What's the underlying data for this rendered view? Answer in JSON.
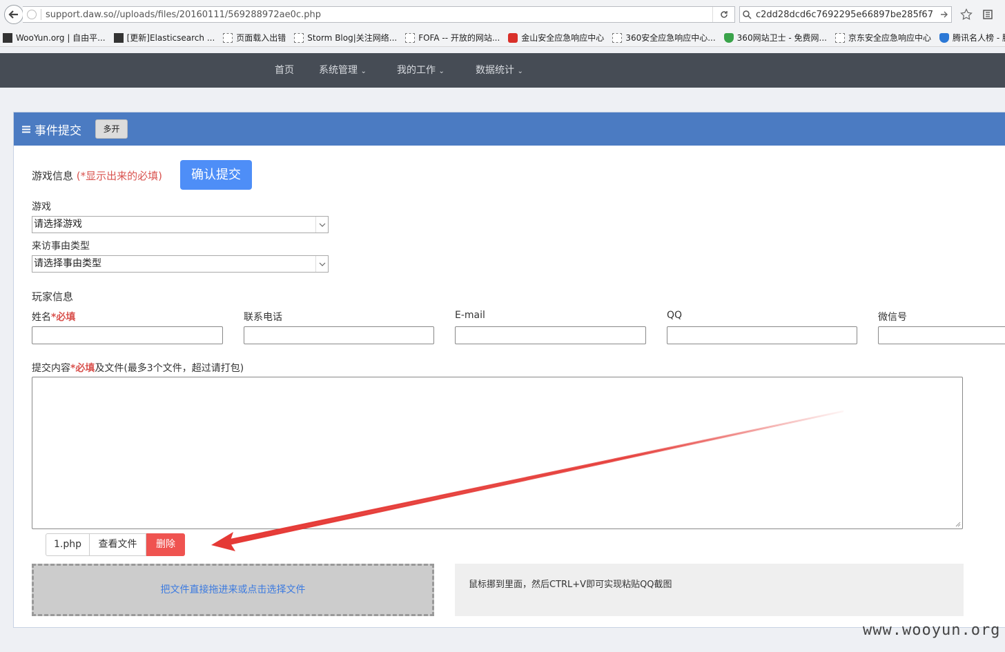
{
  "browser": {
    "url": "support.daw.so//uploads/files/20160111/569288972ae0c.php",
    "search": "c2dd28dcd6c7692295e66897be285f67",
    "bookmarks": [
      {
        "label": "WooYun.org | 自由平...",
        "icon": "dark"
      },
      {
        "label": "[更新]Elasticsearch ...",
        "icon": "dark"
      },
      {
        "label": "页面载入出错",
        "icon": "dash"
      },
      {
        "label": "Storm Blog|关注网络...",
        "icon": "dash"
      },
      {
        "label": "FOFA -- 开放的网站...",
        "icon": "dash"
      },
      {
        "label": "金山安全应急响应中心",
        "icon": "red"
      },
      {
        "label": "360安全应急响应中心...",
        "icon": "dash"
      },
      {
        "label": "360网站卫士 - 免费网...",
        "icon": "green"
      },
      {
        "label": "京东安全应急响应中心",
        "icon": "dash"
      },
      {
        "label": "腾讯名人榜 - 腾讯安...",
        "icon": "blue"
      }
    ]
  },
  "nav": {
    "home": "首页",
    "system": "系统管理",
    "mywork": "我的工作",
    "stats": "数据统计"
  },
  "panel": {
    "title": "事件提交",
    "multi_open": "多开"
  },
  "form": {
    "game_info": "游戏信息",
    "required_hint": "(*显示出来的必填)",
    "confirm": "确认提交",
    "game_label": "游戏",
    "game_select": "请选择游戏",
    "reason_label": "来访事由类型",
    "reason_select": "请选择事由类型",
    "player_info": "玩家信息",
    "name_label": "姓名",
    "star": "*",
    "required": "必填",
    "phone_label": "联系电话",
    "email_label": "E-mail",
    "qq_label": "QQ",
    "wechat_label": "微信号",
    "content_label": "提交内容",
    "content_suffix": "及文件(最多3个文件，超过请打包)"
  },
  "file": {
    "name": "1.php",
    "view": "查看文件",
    "delete": "删除"
  },
  "dropzone": "把文件直接拖进来或点击选择文件",
  "paste_hint": "鼠标挪到里面，然后CTRL+V即可实现粘贴QQ截图",
  "watermark": "www.wooyun.org",
  "colors": {
    "nav_bg": "#464c55",
    "panel_head": "#4b7bc2",
    "confirm": "#4e8ef7",
    "delete": "#ef5350",
    "required": "#d9534f",
    "arrow": "#e53935"
  }
}
